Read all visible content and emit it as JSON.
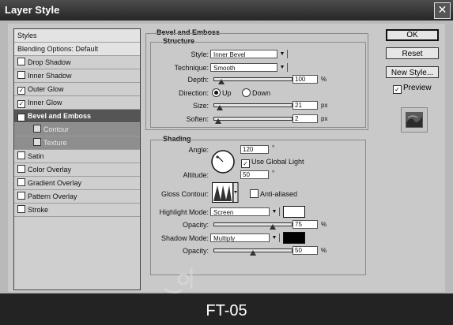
{
  "window": {
    "title": "Layer Style",
    "close_glyph": "✕"
  },
  "left_panel": {
    "header": "Styles",
    "blending": "Blending Options: Default",
    "items": [
      {
        "label": "Drop Shadow",
        "checked": false
      },
      {
        "label": "Inner Shadow",
        "checked": false
      },
      {
        "label": "Outer Glow",
        "checked": true
      },
      {
        "label": "Inner Glow",
        "checked": true
      },
      {
        "label": "Bevel and Emboss",
        "checked": true,
        "selected": true
      },
      {
        "label": "Contour",
        "checked": false,
        "sub": true
      },
      {
        "label": "Texture",
        "checked": false,
        "sub": true
      },
      {
        "label": "Satin",
        "checked": false
      },
      {
        "label": "Color Overlay",
        "checked": false
      },
      {
        "label": "Gradient Overlay",
        "checked": false
      },
      {
        "label": "Pattern Overlay",
        "checked": false
      },
      {
        "label": "Stroke",
        "checked": false
      }
    ]
  },
  "bevel": {
    "title": "Bevel and Emboss",
    "structure_title": "Structure",
    "style_label": "Style:",
    "style_value": "Inner Bevel",
    "technique_label": "Technique:",
    "technique_value": "Smooth",
    "depth_label": "Depth:",
    "depth_value": "100",
    "depth_unit": "%",
    "depth_fraction": 0.1,
    "direction_label": "Direction:",
    "dir_up": "Up",
    "dir_down": "Down",
    "size_label": "Size:",
    "size_value": "21",
    "size_unit": "px",
    "size_fraction": 0.08,
    "soften_label": "Soften:",
    "soften_value": "2",
    "soften_unit": "px",
    "soften_fraction": 0.06,
    "shading_title": "Shading",
    "angle_label": "Angle:",
    "angle_value": "120",
    "angle_unit": "°",
    "global_light_label": "Use Global Light",
    "altitude_label": "Altitude:",
    "altitude_value": "50",
    "altitude_unit": "°",
    "gloss_label": "Gloss Contour:",
    "anti_aliased_label": "Anti-aliased",
    "highlight_label": "Highlight Mode:",
    "highlight_value": "Screen",
    "highlight_color": "#ffffff",
    "hl_opacity_label": "Opacity:",
    "hl_opacity_value": "75",
    "hl_opacity_unit": "%",
    "hl_opacity_fraction": 0.75,
    "shadow_label": "Shadow Mode:",
    "shadow_value": "Multiply",
    "shadow_color": "#000000",
    "sh_opacity_label": "Opacity:",
    "sh_opacity_value": "50",
    "sh_opacity_unit": "%",
    "sh_opacity_fraction": 0.5
  },
  "buttons": {
    "ok": "OK",
    "reset": "Reset",
    "new_style": "New Style...",
    "preview": "Preview"
  },
  "banner": {
    "text": "FT-05"
  }
}
